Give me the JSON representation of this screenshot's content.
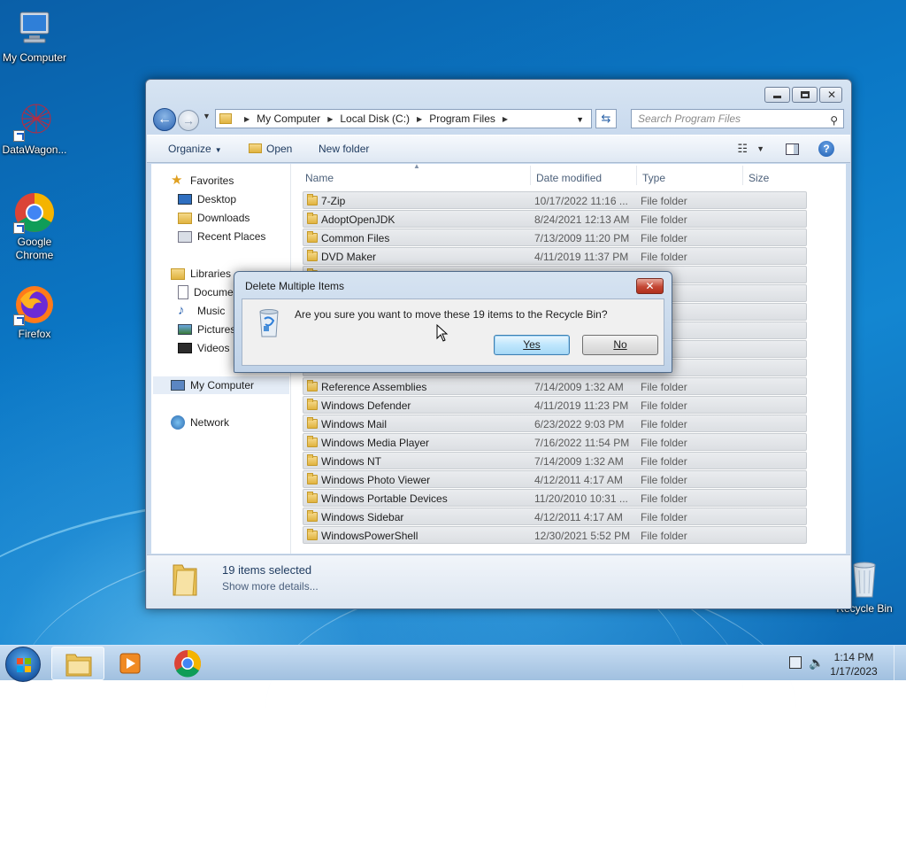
{
  "desktop_icons": [
    {
      "label": "My Computer"
    },
    {
      "label": "DataWagon..."
    },
    {
      "label": "Google Chrome"
    },
    {
      "label": "Firefox"
    },
    {
      "label": "Recycle Bin"
    }
  ],
  "explorer": {
    "breadcrumb": [
      "My Computer",
      "Local Disk (C:)",
      "Program Files"
    ],
    "search_placeholder": "Search Program Files",
    "toolbar": {
      "organize": "Organize",
      "open": "Open",
      "new_folder": "New folder"
    },
    "nav": {
      "favorites": "Favorites",
      "desktop": "Desktop",
      "downloads": "Downloads",
      "recent_places": "Recent Places",
      "libraries": "Libraries",
      "documents": "Docume",
      "music": "Music",
      "pictures": "Pictures",
      "videos": "Videos",
      "my_computer": "My Computer",
      "network": "Network"
    },
    "columns": {
      "name": "Name",
      "date": "Date modified",
      "type": "Type",
      "size": "Size"
    },
    "rows": [
      {
        "name": "7-Zip",
        "date": "10/17/2022 11:16 ...",
        "type": "File folder"
      },
      {
        "name": "AdoptOpenJDK",
        "date": "8/24/2021 12:13 AM",
        "type": "File folder"
      },
      {
        "name": "Common Files",
        "date": "7/13/2009 11:20 PM",
        "type": "File folder"
      },
      {
        "name": "DVD Maker",
        "date": "4/11/2019 11:37 PM",
        "type": "File folder"
      },
      {
        "name": "",
        "date": "",
        "type": "older"
      },
      {
        "name": "",
        "date": "",
        "type": "older"
      },
      {
        "name": "",
        "date": "",
        "type": "older"
      },
      {
        "name": "",
        "date": "",
        "type": "older"
      },
      {
        "name": "",
        "date": "",
        "type": "older"
      },
      {
        "name": "",
        "date": "",
        "type": "older"
      },
      {
        "name": "Reference Assemblies",
        "date": "7/14/2009 1:32 AM",
        "type": "File folder"
      },
      {
        "name": "Windows Defender",
        "date": "4/11/2019 11:23 PM",
        "type": "File folder"
      },
      {
        "name": "Windows Mail",
        "date": "6/23/2022 9:03 PM",
        "type": "File folder"
      },
      {
        "name": "Windows Media Player",
        "date": "7/16/2022 11:54 PM",
        "type": "File folder"
      },
      {
        "name": "Windows NT",
        "date": "7/14/2009 1:32 AM",
        "type": "File folder"
      },
      {
        "name": "Windows Photo Viewer",
        "date": "4/12/2011 4:17 AM",
        "type": "File folder"
      },
      {
        "name": "Windows Portable Devices",
        "date": "11/20/2010 10:31 ...",
        "type": "File folder"
      },
      {
        "name": "Windows Sidebar",
        "date": "4/12/2011 4:17 AM",
        "type": "File folder"
      },
      {
        "name": "WindowsPowerShell",
        "date": "12/30/2021 5:52 PM",
        "type": "File folder"
      }
    ],
    "details": {
      "count": "19 items selected",
      "more": "Show more details..."
    }
  },
  "dialog": {
    "title": "Delete Multiple Items",
    "close": "✕",
    "message": "Are you sure you want to move these 19 items to the Recycle Bin?",
    "yes": "Yes",
    "no": "No"
  },
  "taskbar": {
    "time": "1:14 PM",
    "date": "1/17/2023"
  },
  "colors": {
    "folder": "#e0b340",
    "selection": "#dcdfe3",
    "accent": "#1a5aa8"
  }
}
